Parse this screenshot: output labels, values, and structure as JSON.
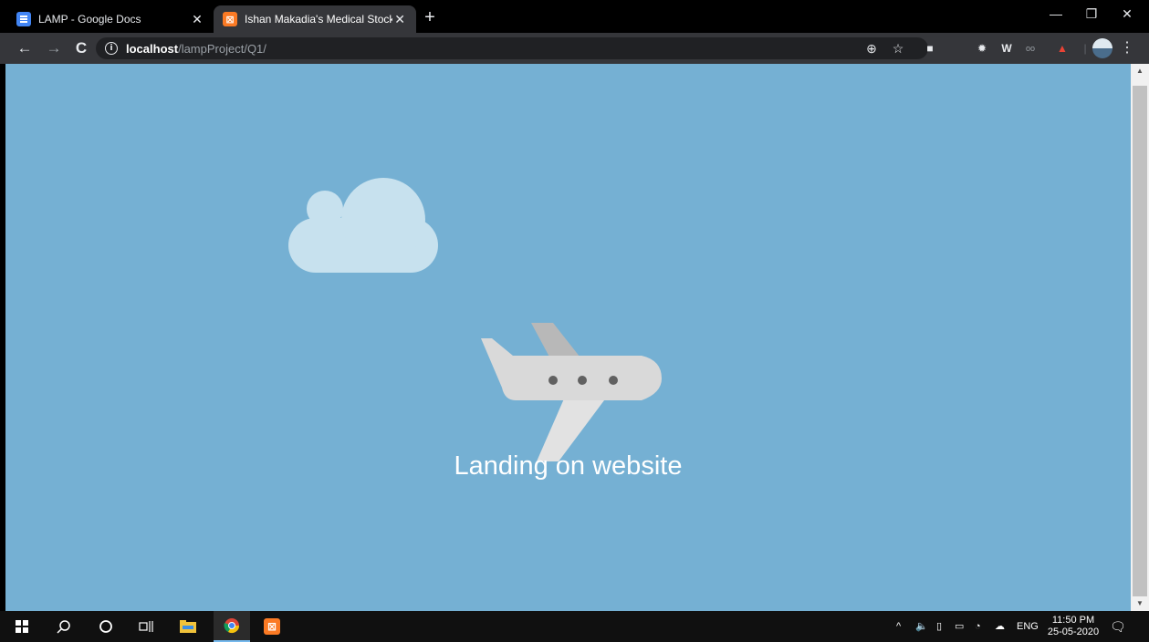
{
  "browser": {
    "tabs": [
      {
        "title": "LAMP - Google Docs",
        "icon": "google-docs-icon",
        "active": false
      },
      {
        "title": "Ishan Makadia's Medical Stock",
        "icon": "xampp-icon",
        "active": true
      }
    ],
    "address_bar": {
      "host": "localhost",
      "path": "/lampProject/Q1/"
    }
  },
  "page": {
    "background_color": "#75b0d3",
    "heading": "Landing on website"
  },
  "taskbar": {
    "language": "ENG",
    "time": "11:50 PM",
    "date": "25-05-2020"
  }
}
